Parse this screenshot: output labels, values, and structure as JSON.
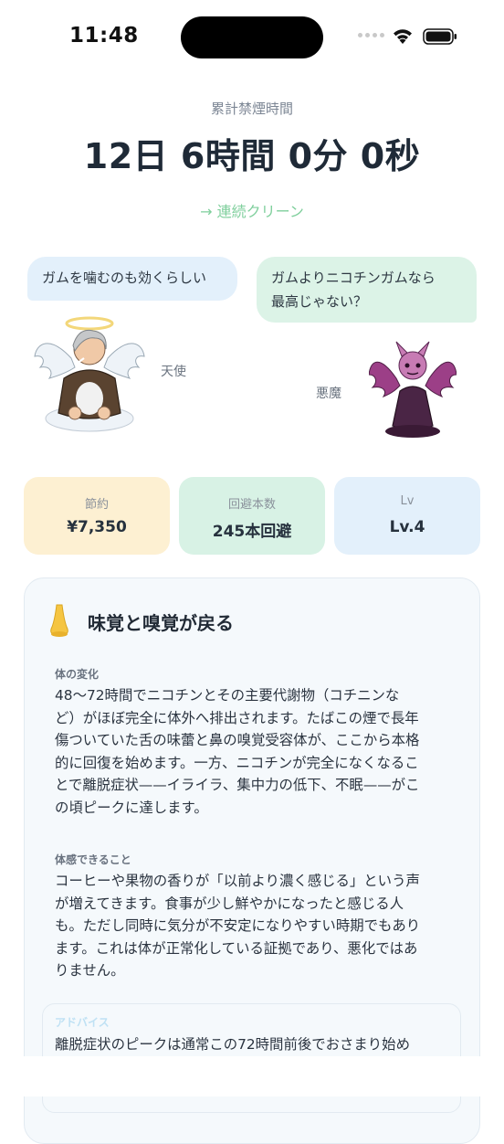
{
  "status_bar": {
    "time": "11:48"
  },
  "header": {
    "label": "累計禁煙時間",
    "duration": "12日 6時間 0分 0秒",
    "streak_link": "→ 連続クリーン"
  },
  "dialogue": {
    "angel": {
      "speech": "ガムを噛むのも効くらしい",
      "name": "天使"
    },
    "devil": {
      "speech_line1": "ガムよりニコチンガムなら",
      "speech_line2": "最高じゃない？",
      "name": "悪魔"
    }
  },
  "stats": [
    {
      "title": "節約",
      "value": "¥7,350"
    },
    {
      "title": "回避本数",
      "value": "245本回避"
    },
    {
      "title": "Lv",
      "value": "Lv.4"
    }
  ],
  "milestone": {
    "icon": "nose-icon",
    "title": "味覚と嗅覚が戻る",
    "body_change_label": "体の変化",
    "body_change_lines": [
      "48〜72時間でニコチンとその主要代謝物（コチニンな",
      "ど）がほぼ完全に体外へ排出されます。たばこの煙で長年",
      "傷ついていた舌の味蕾と鼻の嗅覚受容体が、ここから本格",
      "的に回復を始めます。一方、ニコチンが完全になくなるこ",
      "とで離脱症状——イライラ、集中力の低下、不眠——がこ",
      "の頃ピークに達します。"
    ],
    "feel_label": "体感できること",
    "feel_lines": [
      "コーヒーや果物の香りが「以前より濃く感じる」という声",
      "が増えてきます。食事が少し鮮やかになったと感じる人",
      "も。ただし同時に気分が不安定になりやすい時期でもあり",
      "ます。これは体が正常化している証拠であり、悪化ではあ",
      "りません。"
    ],
    "advice_label": "アドバイス",
    "advice_line": "離脱症状のピークは通常この72時間前後でおさまり始め"
  },
  "colors": {
    "accent_green": "#7fcf9c",
    "angel_bubble": "#e3f0fb",
    "devil_bubble": "#dcf3e7",
    "save_card": "#fdf0d2",
    "avoid_card": "#d8f2e5",
    "level_card": "#e3f0fb"
  }
}
